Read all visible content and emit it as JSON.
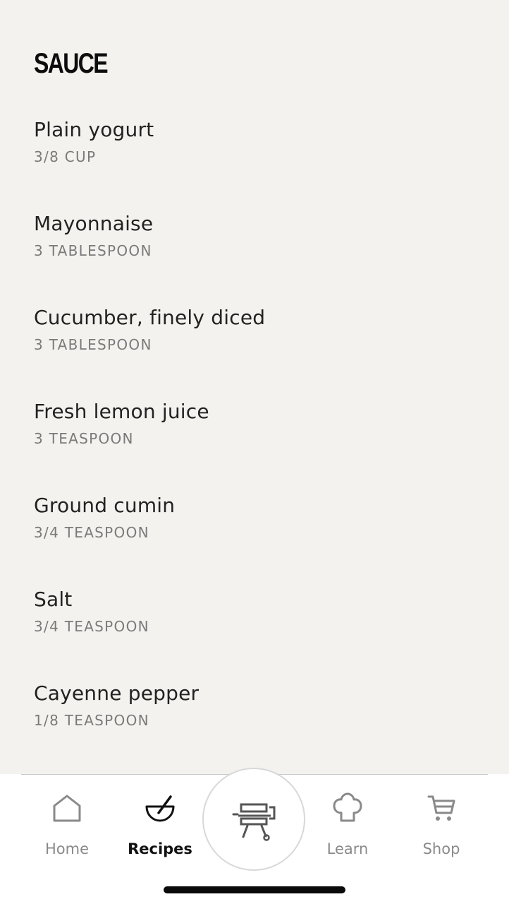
{
  "section": {
    "title": "SAUCE"
  },
  "ingredients": [
    {
      "name": "Plain yogurt",
      "quantity": "3/8 CUP"
    },
    {
      "name": "Mayonnaise",
      "quantity": "3 TABLESPOON"
    },
    {
      "name": "Cucumber, finely diced",
      "quantity": "3 TABLESPOON"
    },
    {
      "name": "Fresh lemon juice",
      "quantity": "3 TEASPOON"
    },
    {
      "name": "Ground cumin",
      "quantity": "3/4 TEASPOON"
    },
    {
      "name": "Salt",
      "quantity": "3/4 TEASPOON"
    },
    {
      "name": "Cayenne pepper",
      "quantity": "1/8 TEASPOON"
    }
  ],
  "tab_bar": {
    "active_tab": "Recipes",
    "tabs": [
      {
        "label": "Home",
        "icon": "home-icon"
      },
      {
        "label": "Recipes",
        "icon": "bowl-icon"
      },
      {
        "label": "Learn",
        "icon": "chef-hat-icon"
      },
      {
        "label": "Shop",
        "icon": "cart-icon"
      }
    ],
    "center_button_icon": "grill-icon"
  },
  "colors": {
    "background": "#f3f2ef",
    "text_primary": "#222222",
    "text_secondary": "#7a7a7a",
    "tab_inactive": "#8a8a8a",
    "tab_active": "#111111"
  }
}
